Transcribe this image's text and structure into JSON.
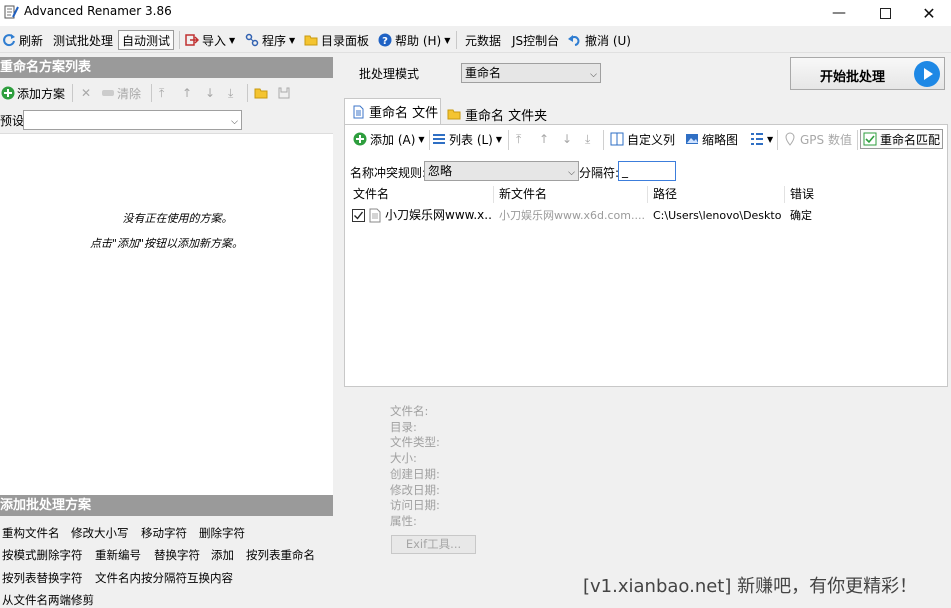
{
  "titlebar": {
    "title": "Advanced Renamer 3.86"
  },
  "toolbar": {
    "refresh": "刷新",
    "test_batch": "测试批处理",
    "auto_test": "自动测试",
    "import": "导入",
    "program": "程序",
    "dir_panel": "目录面板",
    "help": "帮助 (H)",
    "metadata": "元数据",
    "js_console": "JS控制台",
    "undo": "撤消 (U)"
  },
  "left": {
    "methods_header": "重命名方案列表",
    "add_method": "添加方案",
    "clear": "清除",
    "preset_label": "预设:",
    "preset_value": "",
    "empty_line1": "没有正在使用的方案。",
    "empty_line2": "点击\"添加\"按钮以添加新方案。",
    "add_batch_header": "添加批处理方案",
    "batch_methods": [
      [
        "重构文件名",
        "修改大小写",
        "移动字符",
        "删除字符"
      ],
      [
        "按模式删除字符",
        "重新编号",
        "替换字符",
        "添加",
        "按列表重命名"
      ],
      [
        "按列表替换字符",
        "文件名内按分隔符互换内容"
      ],
      [
        "从文件名两端修剪"
      ]
    ]
  },
  "batch_mode": {
    "label": "批处理模式",
    "value": "重命名"
  },
  "start_button": {
    "label": "开始批处理"
  },
  "tabs": [
    {
      "label": "重命名 文件"
    },
    {
      "label": "重命名 文件夹"
    }
  ],
  "file_toolbar": {
    "add": "添加 (A)",
    "list": "列表 (L)",
    "custom_columns": "自定义列",
    "thumbnails": "缩略图",
    "gps": "GPS 数值",
    "rename_match": "重命名匹配"
  },
  "conflict": {
    "label": "名称冲突规则:",
    "value": "忽略",
    "sep_label": "分隔符:",
    "sep_value": "_"
  },
  "columns": [
    "文件名",
    "新文件名",
    "路径",
    "错误"
  ],
  "rows": [
    {
      "checked": true,
      "filename": "小刀娱乐网www.x...",
      "newname": "小刀娱乐网www.x6d.com....",
      "path": "C:\\Users\\lenovo\\Desktop\\",
      "error": "确定"
    }
  ],
  "info_fields": [
    "文件名:",
    "目录:",
    "文件类型:",
    "大小:",
    "创建日期:",
    "修改日期:",
    "访问日期:",
    "属性:"
  ],
  "exif_button": "Exif工具...",
  "watermark": "[v1.xianbao.net] 新赚吧，有你更精彩！",
  "colors": {
    "header_gray": "#9a9a9a",
    "accent_blue": "#1e88e5",
    "add_green": "#2e9e3e"
  }
}
